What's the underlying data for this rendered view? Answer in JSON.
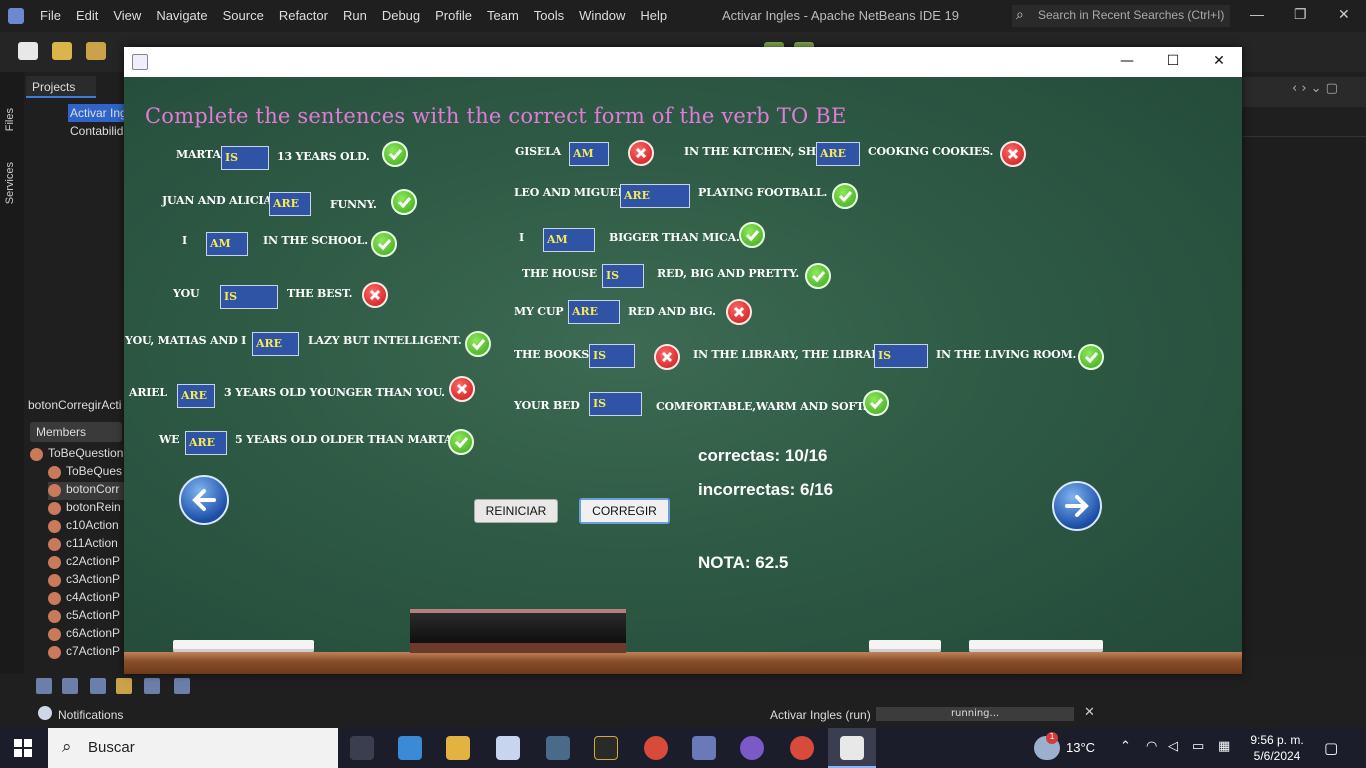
{
  "ide": {
    "menus": [
      "File",
      "Edit",
      "View",
      "Navigate",
      "Source",
      "Refactor",
      "Run",
      "Debug",
      "Profile",
      "Team",
      "Tools",
      "Window",
      "Help"
    ],
    "title": "Activar Ingles - Apache NetBeans IDE 19",
    "search_placeholder": "Search in Recent Searches (Ctrl+I)",
    "projects_tab": "Projects",
    "side_tabs": [
      "Files",
      "Services"
    ],
    "tree": [
      {
        "label": "Activar Ing",
        "selected": true
      },
      {
        "label": "Contabilid",
        "selected": false
      }
    ],
    "navigator_title": "botonCorregirActi",
    "members_select": "Members",
    "members": [
      "ToBeQuestion",
      "ToBeQues",
      "botonCorr",
      "botonRein",
      "c10Action",
      "c11Action",
      "c2ActionP",
      "c3ActionP",
      "c4ActionP",
      "c5ActionP",
      "c6ActionP",
      "c7ActionP"
    ],
    "notifications": "Notifications",
    "run_label": "Activar Ingles (run)",
    "run_status": "running..."
  },
  "app": {
    "heading": "Complete the sentences with the correct form of the verb TO BE",
    "left_items": [
      {
        "before": "Marta",
        "answer": "is",
        "after": "13 years old.",
        "correct": true
      },
      {
        "before": "Juan and Alicia",
        "answer": "are",
        "after": "funny.",
        "correct": true
      },
      {
        "before": "I",
        "answer": "am",
        "after": "in the school.",
        "correct": true
      },
      {
        "before": "You",
        "answer": "is",
        "after": "the best.",
        "correct": false
      },
      {
        "before": "You, Matias and I",
        "answer": "are",
        "after": "lazy but intelligent.",
        "correct": true
      },
      {
        "before": "Ariel",
        "answer": "are",
        "after": "3 years old younger than you.",
        "correct": false
      },
      {
        "before": "We",
        "answer": "are",
        "after": "5 years old older than Marta.",
        "correct": true
      }
    ],
    "right_items": [
      {
        "before": "Gisela",
        "answer": "am",
        "correct": false
      },
      {
        "before": "in the kitchen, she",
        "answer": "are",
        "after": "cooking cookies.",
        "correct": false
      },
      {
        "before": "Leo and Miguel",
        "answer": "are",
        "after": "playing football.",
        "correct": true
      },
      {
        "before": "I",
        "answer": "am",
        "after": "bigger than Mica.",
        "correct": true
      },
      {
        "before": "The house",
        "answer": "is",
        "after": "red, big and pretty.",
        "correct": true
      },
      {
        "before": "My cup",
        "answer": "are",
        "after": "red and big.",
        "correct": false
      },
      {
        "before": "The books",
        "answer": "is",
        "correct": false
      },
      {
        "before": "in the library, the library",
        "answer": "is",
        "after": "in the living room.",
        "correct": true
      },
      {
        "before": "Your bed",
        "answer": "is",
        "after": "comfortable,warm and soft.",
        "correct": true
      }
    ],
    "correctas": "correctas: 10/16",
    "incorrectas": "incorrectas: 6/16",
    "nota": "NOTA: 62.5",
    "reiniciar": "REINICIAR",
    "corregir": "CORREGIR"
  },
  "taskbar": {
    "search": "Buscar",
    "temperature": "13°C",
    "time": "9:56 p. m.",
    "date": "5/6/2024",
    "weather_badge": "1"
  },
  "colors": {
    "board": "#2e5a45",
    "heading": "#e07cd8",
    "field": "#2f54a6",
    "answer_text": "#f7ea4a"
  }
}
